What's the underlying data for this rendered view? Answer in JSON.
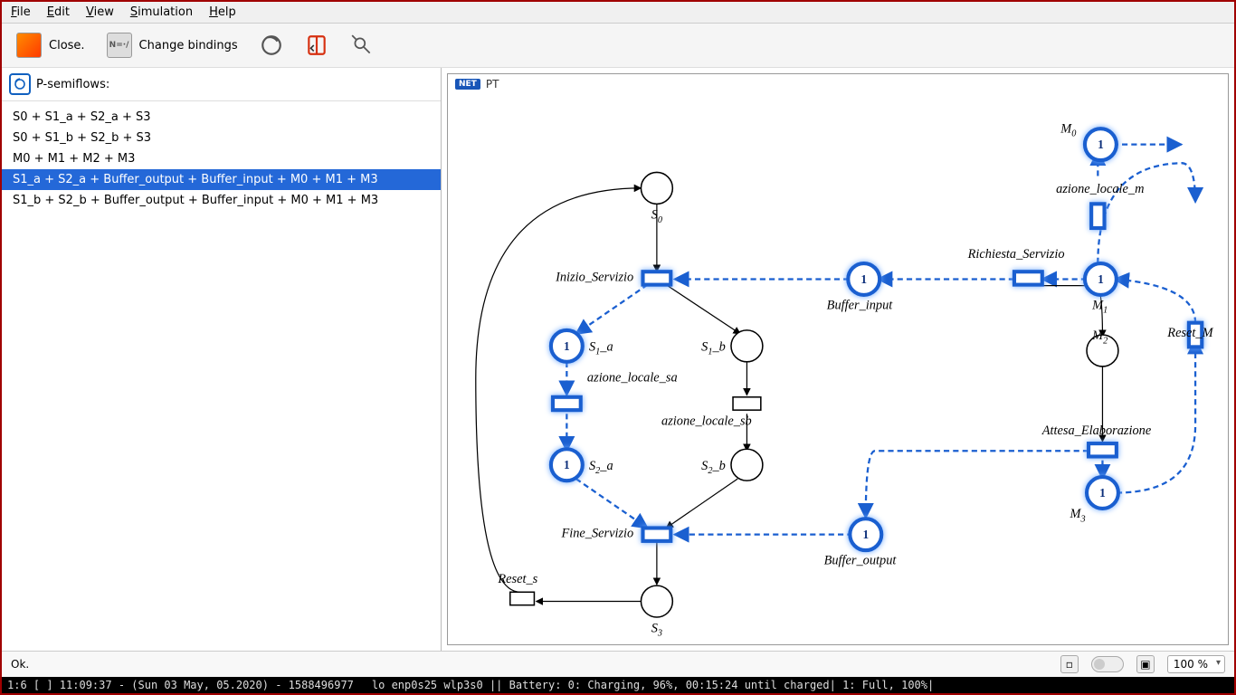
{
  "menu": {
    "file": "File",
    "edit": "Edit",
    "view": "View",
    "sim": "Simulation",
    "help": "Help"
  },
  "toolbar": {
    "close": "Close.",
    "bindings": "Change bindings"
  },
  "panel": {
    "title": "P-semiflows:",
    "items": [
      "S0 + S1_a + S2_a + S3",
      "S0 + S1_b + S2_b + S3",
      "M0 + M1 + M2 + M3",
      "S1_a + S2_a + Buffer_output + Buffer_input + M0 + M1 + M3",
      "S1_b + S2_b + Buffer_output + Buffer_input + M0 + M1 + M3"
    ],
    "selected": 3
  },
  "canvas": {
    "title": "PT"
  },
  "net": {
    "places": {
      "S0": "S₀",
      "S1a": "S₁_a",
      "S1b": "S₁_b",
      "S2a": "S₂_a",
      "S2b": "S₂_b",
      "S3": "S₃",
      "M0": "M₀",
      "M1": "M₁",
      "M2": "M₂",
      "M3": "M₃",
      "Bi": "Buffer_input",
      "Bo": "Buffer_output"
    },
    "transitions": {
      "Inizio": "Inizio_Servizio",
      "asa": "azione_locale_sa",
      "asb": "azione_locale_sb",
      "Fine": "Fine_Servizio",
      "Rs": "Reset_s",
      "Ric": "Richiesta_Servizio",
      "alm": "azione_locale_m",
      "Att": "Attesa_Elaborazione",
      "RM": "Reset_M"
    },
    "token": "1"
  },
  "status": {
    "ok": "Ok.",
    "zoom": "100 %"
  },
  "sys": {
    "left": "1:6 [ ]    11:09:37 - (Sun 03 May, 05.2020) - 1588496977",
    "mid": "lo enp0s25 wlp3s0   ||   Battery: 0: Charging, 96%, 00:15:24 until charged| 1: Full, 100%|"
  }
}
